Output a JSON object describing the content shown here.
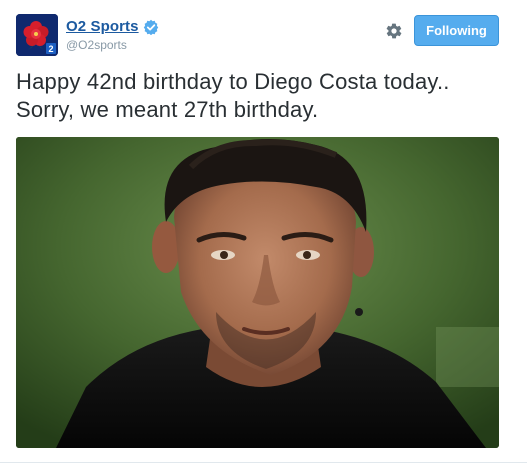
{
  "account": {
    "display_name": "O2 Sports",
    "handle": "@O2sports",
    "verified": true,
    "avatar_icon": "england-rose-logo",
    "avatar_badge": "2"
  },
  "actions": {
    "settings_icon": "gear-icon",
    "follow_label": "Following"
  },
  "tweet": {
    "line1": "Happy 42nd birthday to Diego Costa today..",
    "line2": "Sorry, we meant 27th birthday."
  },
  "media": {
    "type": "photo",
    "subject": "portrait"
  },
  "colors": {
    "link": "#1c5aa0",
    "follow_button": "#55acee",
    "handle": "#8899a6",
    "text": "#292f33"
  }
}
